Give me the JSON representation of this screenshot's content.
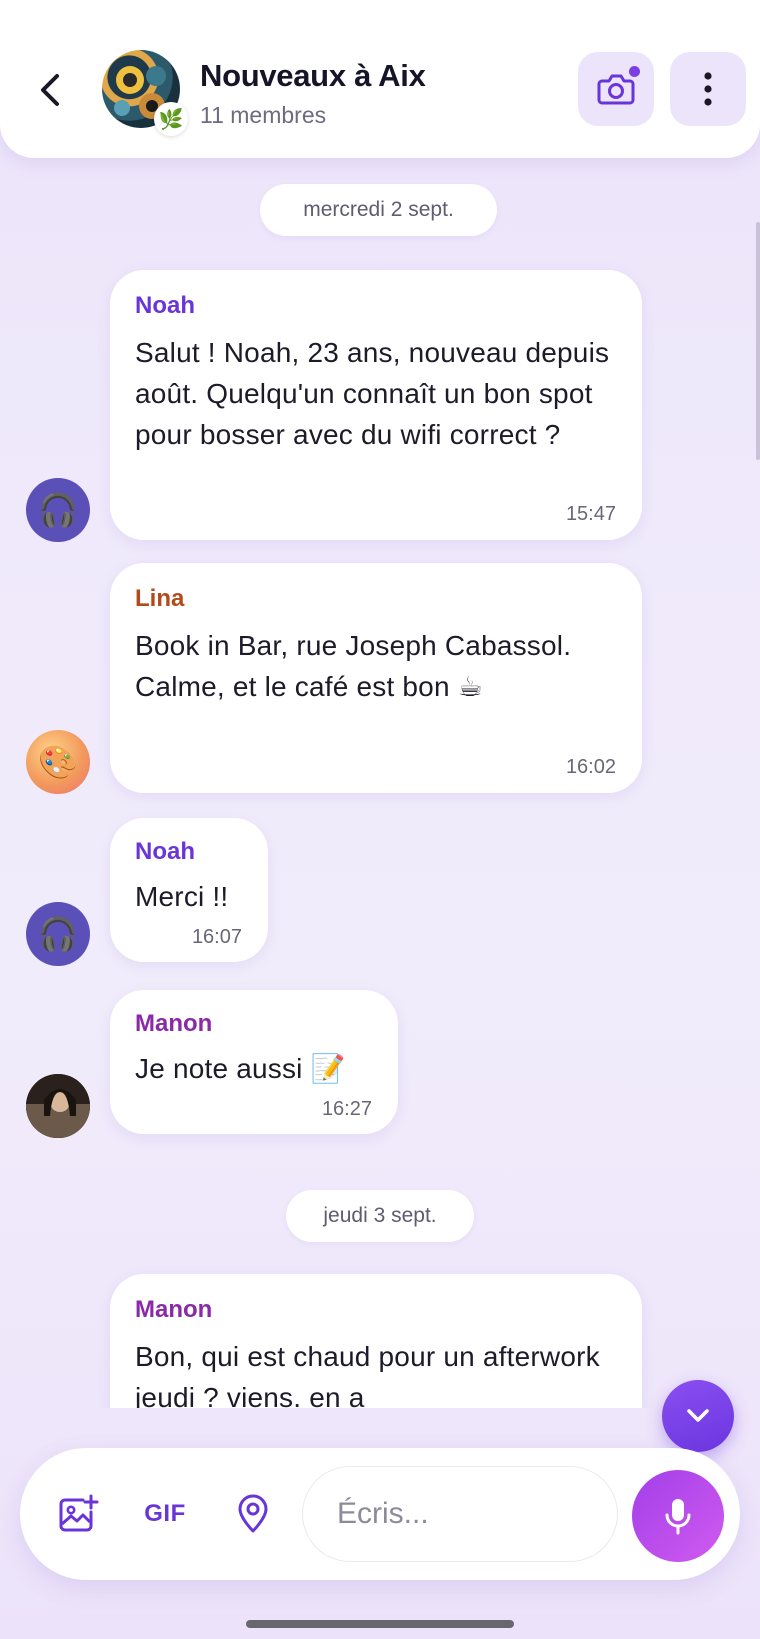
{
  "header": {
    "title": "Nouveaux à Aix",
    "subtitle": "11 membres",
    "badge_emoji": "🌿"
  },
  "dates": {
    "first": "mercredi 2 sept.",
    "second": "jeudi 3 sept."
  },
  "messages": [
    {
      "sender": "Noah",
      "sender_color": "#6a35d8",
      "text": "Salut ! Noah, 23 ans, nouveau depuis août. Quelqu'un connaît un bon spot pour bosser avec du wifi correct ?",
      "time": "15:47",
      "avatar_emoji": "🎧"
    },
    {
      "sender": "Lina",
      "sender_color": "#b34a1a",
      "text": "Book in Bar, rue Joseph Cabassol. Calme, et le café est bon ☕",
      "time": "16:02",
      "avatar_emoji": "🎨"
    },
    {
      "sender": "Noah",
      "sender_color": "#6a35d8",
      "text": "Merci !!",
      "time": "16:07",
      "avatar_emoji": "🎧"
    },
    {
      "sender": "Manon",
      "sender_color": "#8a2aa8",
      "text": "Je note aussi 📝",
      "time": "16:27"
    },
    {
      "sender": "Manon",
      "sender_color": "#8a2aa8",
      "text": "Bon, qui est chaud pour un afterwork jeudi ? viens. en a"
    }
  ],
  "composer": {
    "gif_label": "GIF",
    "placeholder": "Écris..."
  },
  "colors": {
    "accent": "#6a35d8",
    "mic_gradient_start": "#a23fe8",
    "background": "#ece4fa"
  }
}
